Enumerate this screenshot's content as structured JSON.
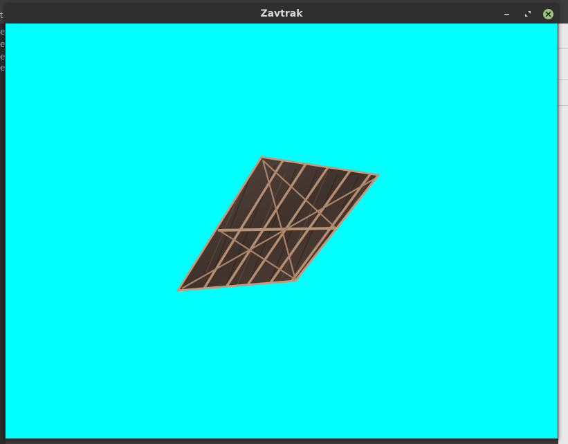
{
  "window": {
    "title": "Zavtrak"
  },
  "viewport": {
    "background_color": "#00ffff",
    "object": "wooden-plank-panel"
  },
  "background_windows": {
    "left_strip_letters": [
      "t",
      "e",
      "e",
      "e",
      "e"
    ]
  },
  "colors": {
    "titlebar": "#2f2f2f",
    "title_text": "#d8d8d8",
    "close_button": "#9cc47f",
    "wood_dark": "#4a3b33",
    "wood_light": "#b08a6a"
  },
  "icons": {
    "minimize": "minimize-icon",
    "maximize": "maximize-icon",
    "close": "close-icon"
  }
}
